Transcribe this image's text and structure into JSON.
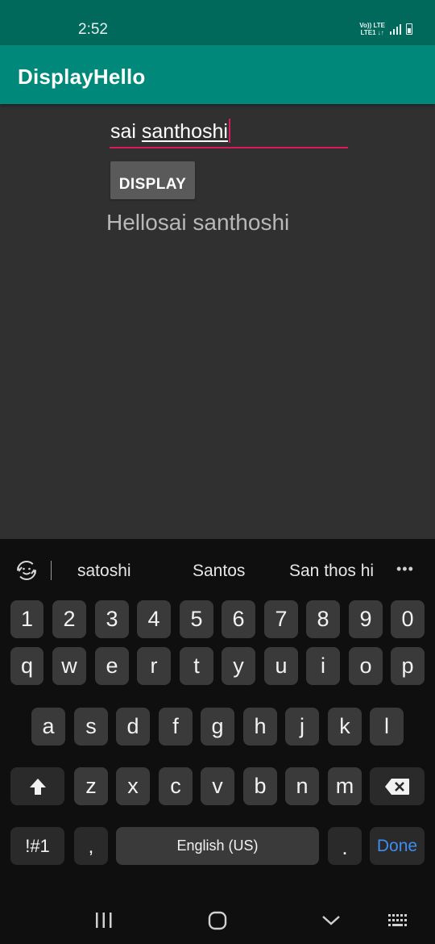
{
  "status_bar": {
    "time": "2:52",
    "network_label_top": "Vo)) LTE",
    "network_label_bottom": "LTE1 ↓↑"
  },
  "app_bar": {
    "title": "DisplayHello"
  },
  "form": {
    "input_prefix": "sai ",
    "input_composing": "santhoshi",
    "button_label": "DISPLAY",
    "output_text": "Hellosai santhoshi",
    "accent_color": "#d81b60"
  },
  "keyboard": {
    "suggestions": [
      "satoshi",
      "Santos",
      "San thos hi"
    ],
    "number_row": [
      "1",
      "2",
      "3",
      "4",
      "5",
      "6",
      "7",
      "8",
      "9",
      "0"
    ],
    "row1": [
      "q",
      "w",
      "e",
      "r",
      "t",
      "y",
      "u",
      "i",
      "o",
      "p"
    ],
    "row2": [
      "a",
      "s",
      "d",
      "f",
      "g",
      "h",
      "j",
      "k",
      "l"
    ],
    "row3": [
      "z",
      "x",
      "c",
      "v",
      "b",
      "n",
      "m"
    ],
    "symbols_key": "!#1",
    "comma_key": ",",
    "space_label": "English (US)",
    "period_key": ".",
    "done_label": "Done"
  },
  "colors": {
    "status_bar": "#00695c",
    "app_bar": "#00897b",
    "background": "#303030",
    "done_blue": "#3d8ef0"
  }
}
